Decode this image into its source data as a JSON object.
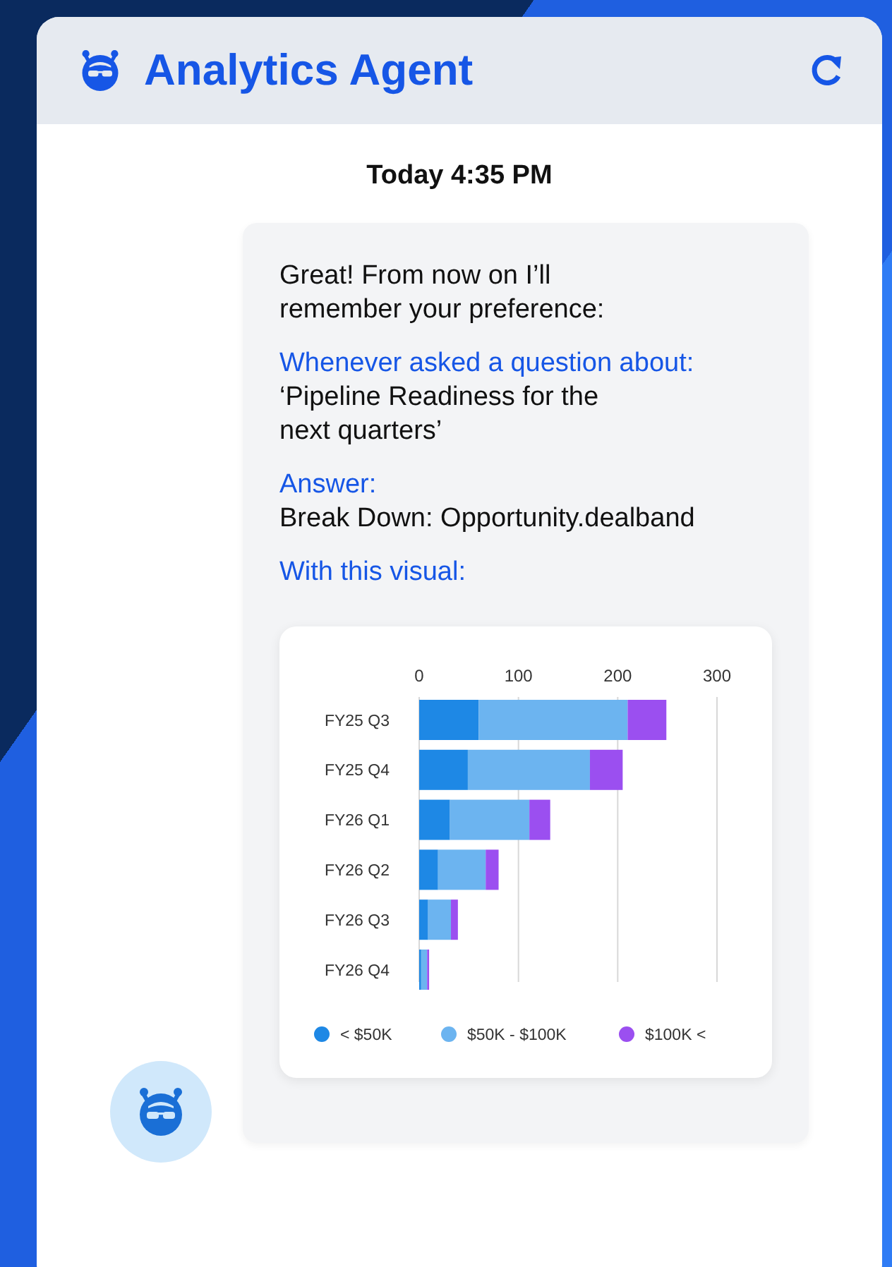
{
  "header": {
    "title": "Analytics Agent"
  },
  "message": {
    "time": "Today 4:35 PM",
    "intro": [
      "Great! From now on I’ll",
      "remember your preference:"
    ],
    "sections": [
      {
        "label": "Whenever asked a question about:",
        "value": [
          "‘Pipeline Readiness for the",
          "next quarters’"
        ]
      },
      {
        "label": "Answer:",
        "value": [
          "Break Down: Opportunity.dealband"
        ]
      },
      {
        "label": "With this visual:"
      }
    ],
    "chart_data": {
      "type": "bar",
      "orientation": "horizontal",
      "stacked": true,
      "categories": [
        "FY25 Q3",
        "FY25 Q4",
        "FY26 Q1",
        "FY26 Q2",
        "FY26 Q3",
        "FY26 Q4"
      ],
      "xticks": [
        0,
        100,
        200,
        300
      ],
      "xlim": [
        0,
        300
      ],
      "legend": true,
      "series": [
        {
          "name": "< $50K",
          "color": "#1e88e5",
          "values": [
            60,
            49,
            31,
            19,
            9,
            2
          ]
        },
        {
          "name": "$50K - $100K",
          "color": "#6cb4f0",
          "values": [
            150,
            123,
            80,
            48,
            23,
            6
          ]
        },
        {
          "name": "$100K <",
          "color": "#9b4ff0",
          "values": [
            39,
            33,
            21,
            13,
            7,
            2
          ]
        }
      ]
    }
  }
}
